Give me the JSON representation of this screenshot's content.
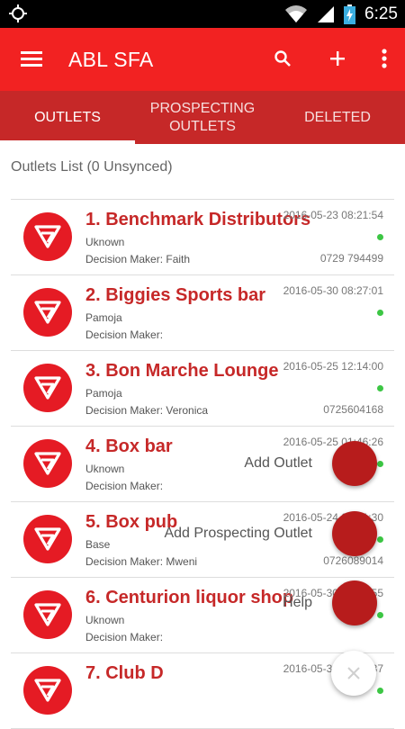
{
  "status_bar": {
    "time": "6:25",
    "battery_level": 0.8
  },
  "app_bar": {
    "title": "ABL SFA",
    "icons": [
      "menu-icon",
      "search-icon",
      "add-icon",
      "more-vert-icon"
    ]
  },
  "tabs": [
    {
      "label": "OUTLETS",
      "active": true
    },
    {
      "label": "PROSPECTING\nOUTLETS",
      "active": false
    },
    {
      "label": "DELETED",
      "active": false
    }
  ],
  "list_header": "Outlets List (0 Unsynced)",
  "outlets": [
    {
      "name": "1. Benchmark Distributors",
      "type": "Uknown",
      "decision_maker": "Decision Maker: Faith",
      "date": "2016-05-23 08:21:54",
      "phone": "0729 794499"
    },
    {
      "name": "2. Biggies Sports bar",
      "type": "Pamoja",
      "decision_maker": "Decision Maker:",
      "date": "2016-05-30 08:27:01",
      "phone": ""
    },
    {
      "name": "3. Bon Marche Lounge",
      "type": "Pamoja",
      "decision_maker": "Decision Maker: Veronica",
      "date": "2016-05-25 12:14:00",
      "phone": "0725604168"
    },
    {
      "name": "4. Box bar",
      "type": "Uknown",
      "decision_maker": "Decision Maker:",
      "date": "2016-05-25 01:46:26",
      "phone": ""
    },
    {
      "name": "5. Box pub",
      "type": "Base",
      "decision_maker": "Decision Maker: Mweni",
      "date": "2016-05-24 09:41:30",
      "phone": "0726089014"
    },
    {
      "name": "6. Centurion liquor shop",
      "type": "Uknown",
      "decision_maker": "Decision Maker:",
      "date": "2016-05-30 06:16:55",
      "phone": ""
    },
    {
      "name": "7. Club D",
      "type": "",
      "decision_maker": "",
      "date": "2016-05-30 08:01:37",
      "phone": ""
    }
  ],
  "fab_menu": {
    "add_outlet": "Add Outlet",
    "add_prospecting": "Add Prospecting Outlet",
    "help": "Help",
    "close_icon": "close-icon"
  },
  "colors": {
    "primary": "#f22222",
    "tab_bar": "#c62828",
    "fab": "#b71c1c",
    "sync_dot": "#3cc644"
  }
}
